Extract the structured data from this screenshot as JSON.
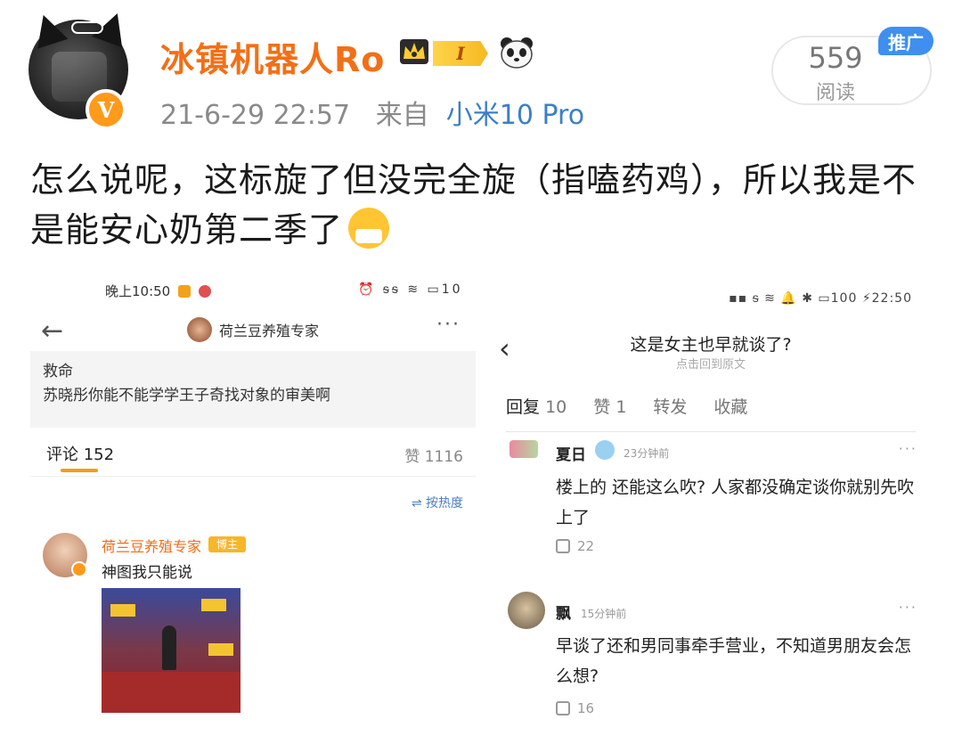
{
  "post": {
    "username": "冰镇机器人Ro",
    "level": "I",
    "date": "21-6-29 22:57",
    "source_prefix": "来自",
    "device": "小米10 Pro",
    "read_count": "559",
    "read_label": "阅读",
    "promo_label": "推广",
    "text": "怎么说呢，这标旋了但没完全旋（指嗑药鸡），所以我是不是能安心奶第二季了",
    "icons": [
      "vip-v-icon",
      "crown-icon",
      "panda-icon",
      "sneeze-emoji-icon"
    ],
    "accent_color": "#f36f16",
    "link_color": "#3c7fc8"
  },
  "left_screenshot": {
    "status_time": "晚上10:50",
    "status_right": "⏰ ᵴᵴ ≋ ▭10",
    "title": "荷兰豆养殖专家",
    "body_line1": "救命",
    "body_line2": "苏晓彤你能不能学学王子奇找对象的审美啊",
    "comments_label": "评论 152",
    "likes_label": "赞 1116",
    "sort_label": "按热度",
    "comment": {
      "author": "荷兰豆养殖专家",
      "tag": "博主",
      "text": "神图我只能说"
    }
  },
  "right_screenshot": {
    "status": "▪▪ ᵴ ≋ 🔔 ✱ ▭100 ⚡22:50",
    "title": "这是女主也早就谈了?",
    "subtitle": "点击回到原文",
    "tabs": [
      {
        "label": "回复",
        "count": "10"
      },
      {
        "label": "赞",
        "count": "1"
      },
      {
        "label": "转发",
        "count": ""
      },
      {
        "label": "收藏",
        "count": ""
      }
    ],
    "comments": [
      {
        "author": "夏日",
        "time": "23分钟前",
        "text": "楼上的 还能这么吹? 人家都没确定谈你就别先吹上了",
        "likes": "22"
      },
      {
        "author": "飘",
        "time": "15分钟前",
        "text": "早谈了还和男同事牵手营业，不知道男朋友会怎么想?",
        "likes": "16"
      }
    ]
  }
}
